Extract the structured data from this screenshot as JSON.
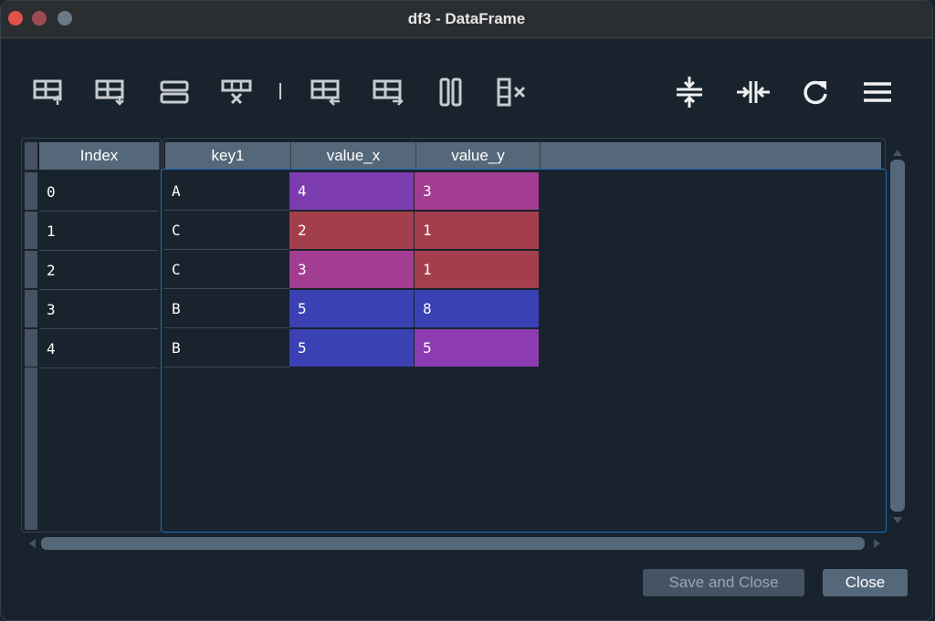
{
  "window": {
    "title": "df3 - DataFrame"
  },
  "toolbar": {
    "left_icons": [
      "insert-row-above-icon",
      "insert-row-below-icon",
      "duplicate-row-icon",
      "remove-row-icon",
      "insert-column-left-icon",
      "insert-column-right-icon",
      "duplicate-column-icon",
      "remove-column-icon"
    ],
    "right_icons": [
      "resize-rows-icon",
      "resize-columns-icon",
      "refresh-icon",
      "options-menu-icon"
    ]
  },
  "table": {
    "index_header": "Index",
    "columns": [
      "key1",
      "value_x",
      "value_y"
    ],
    "index": [
      "0",
      "1",
      "2",
      "3",
      "4"
    ],
    "rows": [
      [
        "A",
        "4",
        "3"
      ],
      [
        "C",
        "2",
        "1"
      ],
      [
        "C",
        "3",
        "1"
      ],
      [
        "B",
        "5",
        "8"
      ],
      [
        "B",
        "5",
        "5"
      ]
    ],
    "cell_colors": {
      "value_x": [
        "#7d3bb0",
        "#a33f4d",
        "#a33d91",
        "#3a41b2",
        "#3a41b2"
      ],
      "value_y": [
        "#a33d91",
        "#a33f4d",
        "#a33f4d",
        "#3a41b2",
        "#8c3cb0"
      ]
    },
    "key_cell_bg": "#19232d",
    "header_bg": "#54687a"
  },
  "buttons": {
    "save_close": "Save and Close",
    "close": "Close"
  },
  "colors": {
    "background": "#19232d",
    "selection_border": "#1a72bb",
    "button_bg": "#54687a"
  }
}
